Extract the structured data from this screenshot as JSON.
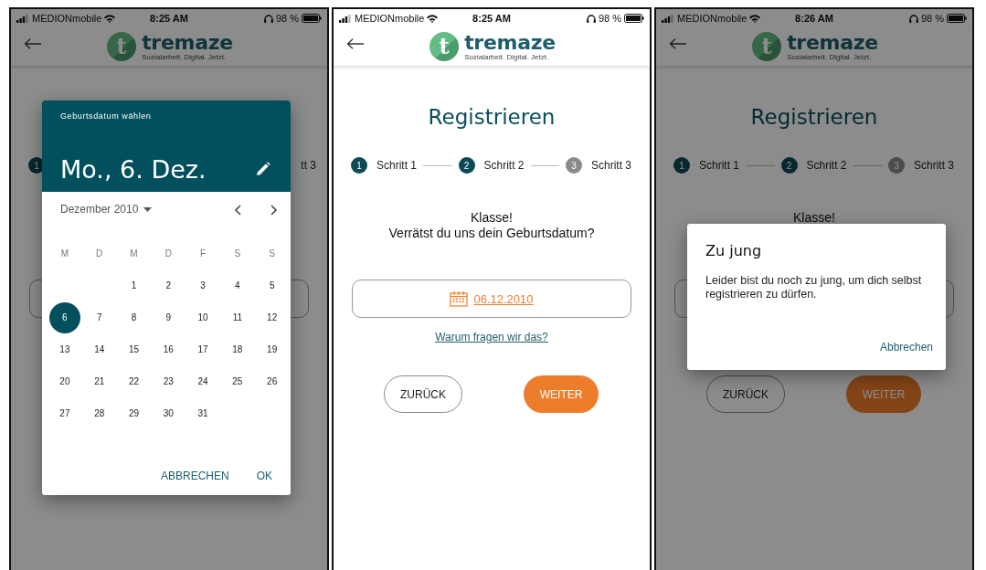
{
  "screens": [
    {
      "status_bar": {
        "carrier": "MEDIONmobile",
        "time": "8:25 AM",
        "battery": "98 %"
      },
      "header": {
        "logo_letter": "t",
        "brand": "tremaze",
        "tagline": "Sozialarbeit. Digital. Jetzt."
      },
      "dimmed": true,
      "page": {
        "steps": [
          {
            "number": "1",
            "active": true
          }
        ],
        "step_tail": "tt 3",
        "field": {
          "kind": "date"
        }
      },
      "dialog": {
        "kind": "datepicker",
        "label": "Geburtsdatum wählen",
        "date": "Mo., 6. Dez.",
        "month": "Dezember 2010",
        "weekdays": [
          "M",
          "D",
          "M",
          "D",
          "F",
          "S",
          "S"
        ],
        "weeks": [
          [
            {
              "day": "1",
              "selected": false
            },
            {
              "day": "2",
              "selected": false
            },
            {
              "day": "3",
              "selected": false
            },
            {
              "day": "4",
              "selected": false
            },
            {
              "day": "5",
              "selected": false
            }
          ],
          [
            {
              "day": "6",
              "selected": true
            },
            {
              "day": "7",
              "selected": false
            },
            {
              "day": "8",
              "selected": false
            },
            {
              "day": "9",
              "selected": false
            },
            {
              "day": "10",
              "selected": false
            },
            {
              "day": "11",
              "selected": false
            },
            {
              "day": "12",
              "selected": false
            }
          ],
          [
            {
              "day": "13",
              "selected": false
            },
            {
              "day": "14",
              "selected": false
            },
            {
              "day": "15",
              "selected": false
            },
            {
              "day": "16",
              "selected": false
            },
            {
              "day": "17",
              "selected": false
            },
            {
              "day": "18",
              "selected": false
            },
            {
              "day": "19",
              "selected": false
            }
          ],
          [
            {
              "day": "20",
              "selected": false
            },
            {
              "day": "21",
              "selected": false
            },
            {
              "day": "22",
              "selected": false
            },
            {
              "day": "23",
              "selected": false
            },
            {
              "day": "24",
              "selected": false
            },
            {
              "day": "25",
              "selected": false
            },
            {
              "day": "26",
              "selected": false
            }
          ],
          [
            {
              "day": "27",
              "selected": false
            },
            {
              "day": "28",
              "selected": false
            },
            {
              "day": "29",
              "selected": false
            },
            {
              "day": "30",
              "selected": false
            },
            {
              "day": "31",
              "selected": false
            }
          ]
        ],
        "actions": [
          "ABBRECHEN",
          "OK"
        ]
      }
    },
    {
      "status_bar": {
        "carrier": "MEDIONmobile",
        "time": "8:25 AM",
        "battery": "98 %"
      },
      "header": {
        "logo_letter": "t",
        "brand": "tremaze",
        "tagline": "Sozialarbeit. Digital. Jetzt."
      },
      "dimmed": false,
      "page": {
        "title": "Registrieren",
        "steps": [
          {
            "number": "1",
            "label": "Schritt 1",
            "active": true
          },
          {
            "number": "2",
            "label": "Schritt 2",
            "active": true
          },
          {
            "number": "3",
            "label": "Schritt 3",
            "active": false
          }
        ],
        "question": [
          "Klasse!",
          "Verrätst du uns dein Geburtsdatum?"
        ],
        "field": {
          "kind": "date",
          "value": "06.12.2010"
        },
        "link": "Warum fragen wir das?",
        "buttons": [
          {
            "label": "ZURÜCK",
            "kind": "outline"
          },
          {
            "label": "WEITER",
            "kind": "primary"
          }
        ]
      }
    },
    {
      "status_bar": {
        "carrier": "MEDIONmobile",
        "time": "8:26 AM",
        "battery": "98 %"
      },
      "header": {
        "logo_letter": "t",
        "brand": "tremaze",
        "tagline": "Sozialarbeit. Digital. Jetzt."
      },
      "dimmed": true,
      "page": {
        "title": "Registrieren",
        "steps": [
          {
            "number": "1",
            "label": "Schritt 1",
            "active": true
          },
          {
            "number": "2",
            "label": "Schritt 2",
            "active": true
          },
          {
            "number": "3",
            "label": "Schritt 3",
            "active": false
          }
        ],
        "question": [
          "Klasse!"
        ],
        "field": {
          "kind": "date"
        },
        "buttons": [
          {
            "label": "ZURÜCK",
            "kind": "outline"
          },
          {
            "label": "WEITER",
            "kind": "primary"
          }
        ]
      },
      "dialog": {
        "kind": "alert",
        "title": "Zu jung",
        "message": "Leider bist du noch zu jung, um dich selbst registrieren zu dürfen.",
        "action": "Abbrechen"
      }
    }
  ]
}
